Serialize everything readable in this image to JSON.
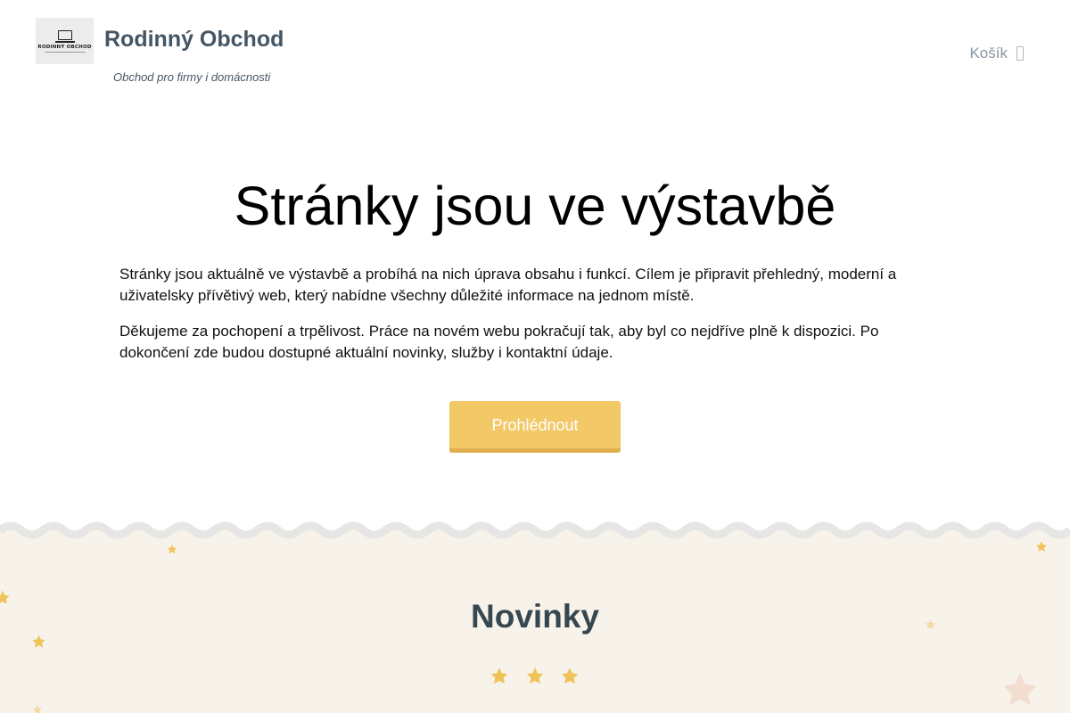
{
  "header": {
    "logo_text": "RODINNÝ OBCHOD",
    "site_title": "Rodinný Obchod",
    "tagline": "Obchod pro firmy i domácnosti",
    "cart_label": "Košík",
    "cart_icon": "shopping-bag-icon"
  },
  "hero": {
    "title": "Stránky jsou ve výstavbě",
    "paragraph1": "Stránky jsou aktuálně ve výstavbě a probíhá na nich úprava obsahu i funkcí. Cílem je připravit přehledný, moderní a uživatelsky přívětivý web, který nabídne všechny důležité informace na jednom místě.",
    "paragraph2": "Děkujeme za pochopení a trpělivost. Práce na novém webu pokračují tak, aby byl co nejdříve plně k dispozici. Po dokončení zde budou dostupné aktuální novinky, služby i kontaktní údaje.",
    "button_label": "Prohlédnout"
  },
  "news": {
    "title": "Novinky"
  },
  "colors": {
    "accent": "#f3c867",
    "heading": "#37474f",
    "section_bg": "#f7f2ea",
    "star": "#f0c35a"
  }
}
